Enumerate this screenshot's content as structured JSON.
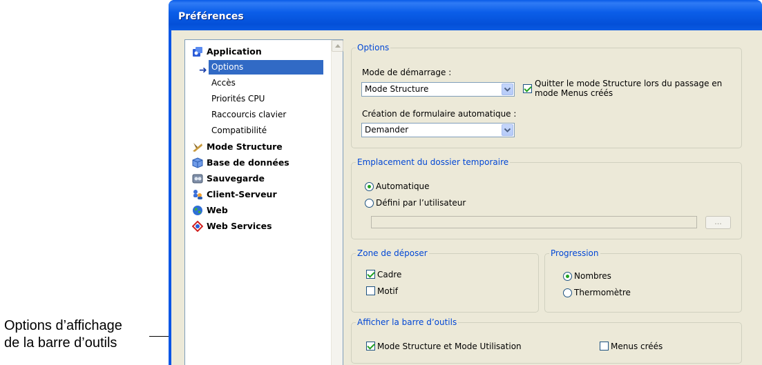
{
  "callout": {
    "line1": "Options d’affichage",
    "line2": "de la barre d’outils"
  },
  "window": {
    "title": "Préférences"
  },
  "tree": {
    "application": "Application",
    "options": "Options",
    "acces": "Accès",
    "priorites": "Priorités CPU",
    "raccourcis": "Raccourcis clavier",
    "compatibilite": "Compatibilité",
    "mode_structure": "Mode Structure",
    "base": "Base de données",
    "sauvegarde": "Sauvegarde",
    "client_serveur": "Client-Serveur",
    "web": "Web",
    "web_services": "Web Services"
  },
  "options_group": {
    "title": "Options",
    "startup_label": "Mode de démarrage :",
    "startup_value": "Mode Structure",
    "quit_checked": true,
    "quit_line1": "Quitter le mode Structure lors du passage en",
    "quit_line2": "mode Menus créés",
    "form_label": "Création de formulaire automatique :",
    "form_value": "Demander"
  },
  "temp_group": {
    "title": "Emplacement du dossier temporaire",
    "auto": "Automatique",
    "user": "Défini par l’utilisateur",
    "selected": "auto",
    "browse": "..."
  },
  "drop_group": {
    "title": "Zone de déposer",
    "cadre": "Cadre",
    "cadre_checked": true,
    "motif": "Motif",
    "motif_checked": false
  },
  "progress_group": {
    "title": "Progression",
    "nombres": "Nombres",
    "thermo": "Thermomètre",
    "selected": "nombres"
  },
  "toolbar_group": {
    "title": "Afficher la barre d’outils",
    "mode_label": "Mode Structure et Mode Utilisation",
    "mode_checked": true,
    "menus_label": "Menus créés",
    "menus_checked": false
  },
  "colors": {
    "title_bar": "#0a56e6",
    "group_title": "#0046d5",
    "selection": "#316ac5",
    "dialog_bg": "#ece9d8"
  }
}
